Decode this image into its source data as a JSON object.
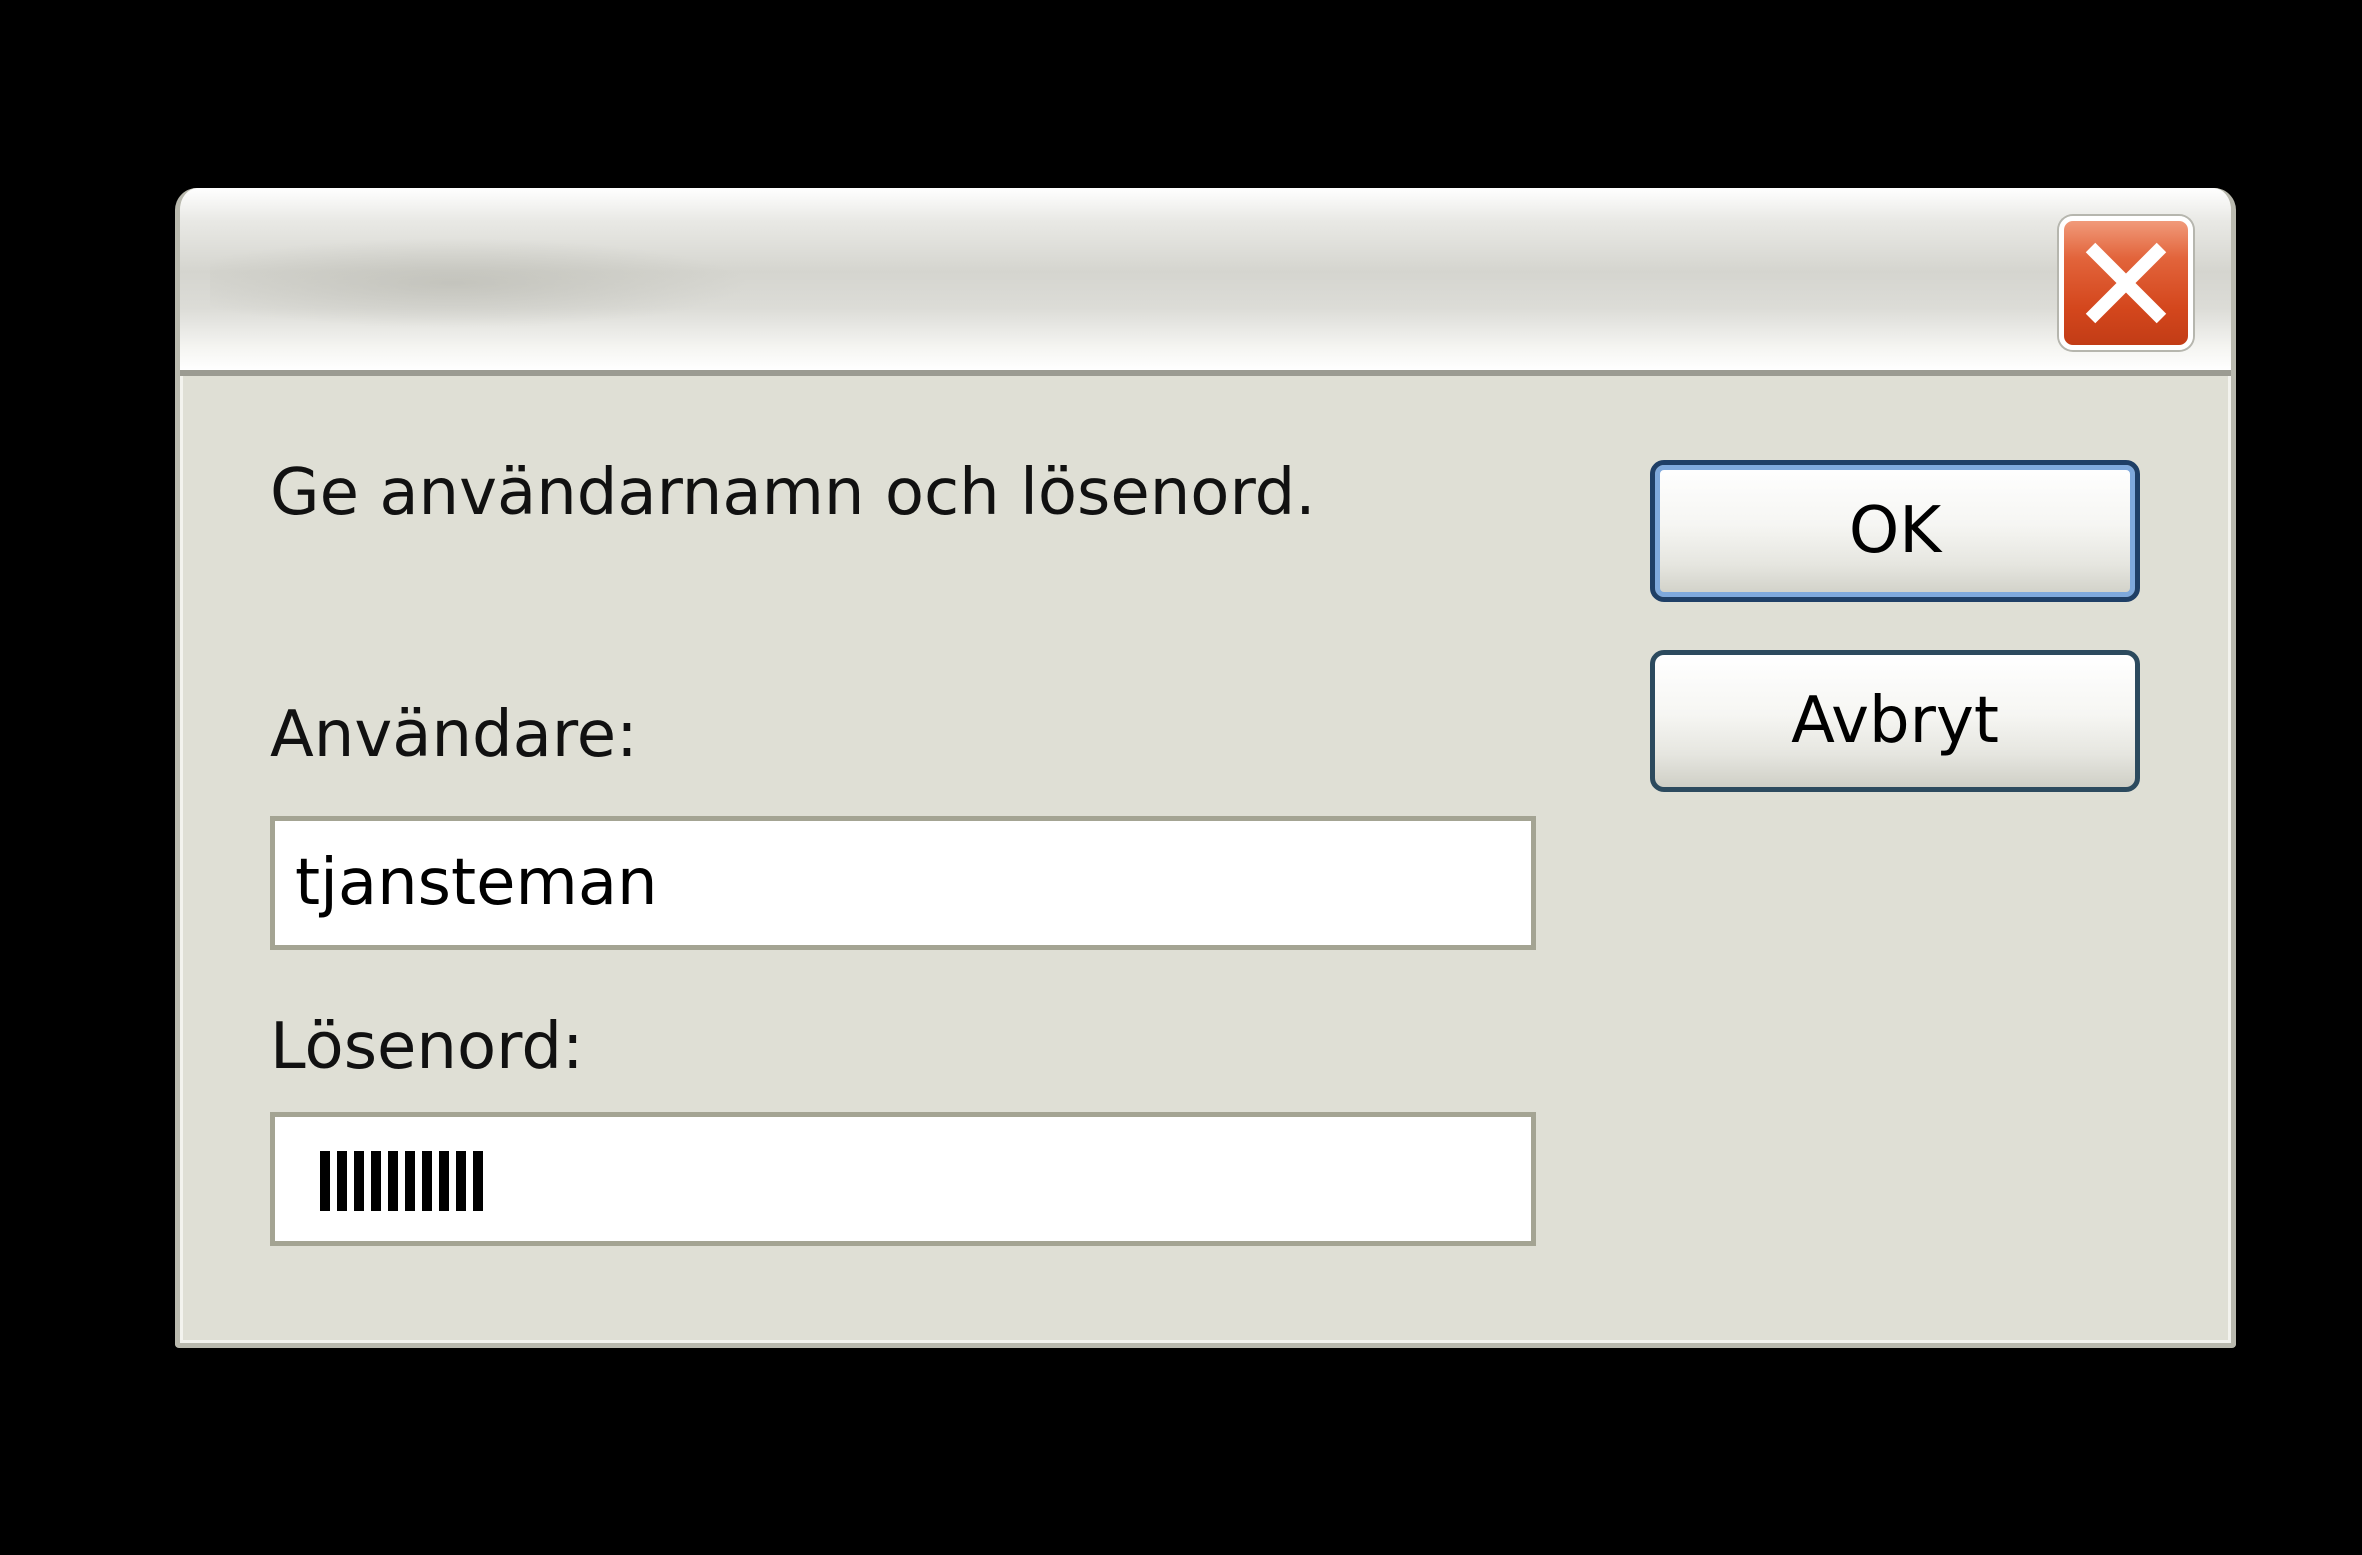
{
  "dialog": {
    "title": "",
    "close_icon": "close-x-icon",
    "prompt": "Ge användarnamn och lösenord.",
    "username_label": "Användare:",
    "username_value": "tjansteman",
    "password_label": "Lösenord:",
    "password_mask_length": 10,
    "buttons": {
      "ok": "OK",
      "cancel": "Avbryt"
    }
  },
  "colors": {
    "dialog_bg": "#dfdfd5",
    "close_red": "#d4471d",
    "button_border": "#1f3f66"
  }
}
